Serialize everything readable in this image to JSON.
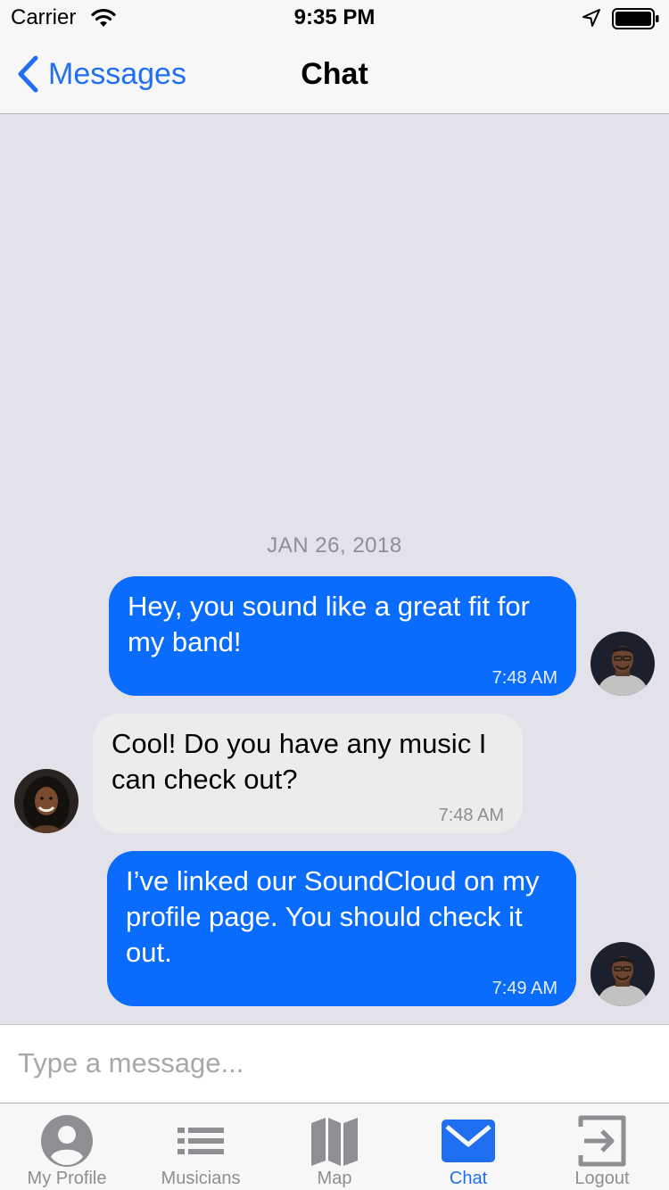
{
  "status_bar": {
    "carrier": "Carrier",
    "time": "9:35 PM"
  },
  "nav": {
    "back_label": "Messages",
    "title": "Chat"
  },
  "chat": {
    "date": "JAN 26, 2018",
    "messages": [
      {
        "direction": "outgoing",
        "text": "Hey, you sound like a great fit for my band!",
        "time": "7:48 AM"
      },
      {
        "direction": "incoming",
        "text": "Cool! Do you have any music I can check out?",
        "time": "7:48 AM"
      },
      {
        "direction": "outgoing",
        "text": "I’ve linked our SoundCloud on my profile page. You should check it out.",
        "time": "7:49 AM"
      }
    ]
  },
  "input": {
    "placeholder": "Type a message..."
  },
  "tabs": [
    {
      "label": "My Profile",
      "icon": "person-circle-icon",
      "active": false
    },
    {
      "label": "Musicians",
      "icon": "list-icon",
      "active": false
    },
    {
      "label": "Map",
      "icon": "map-icon",
      "active": false
    },
    {
      "label": "Chat",
      "icon": "envelope-icon",
      "active": true
    },
    {
      "label": "Logout",
      "icon": "logout-icon",
      "active": false
    }
  ],
  "colors": {
    "accent": "#1f6ff0",
    "outgoing_bubble": "#0a6cfd",
    "incoming_bubble": "#ececec",
    "inactive_tab": "#8e8e93"
  }
}
